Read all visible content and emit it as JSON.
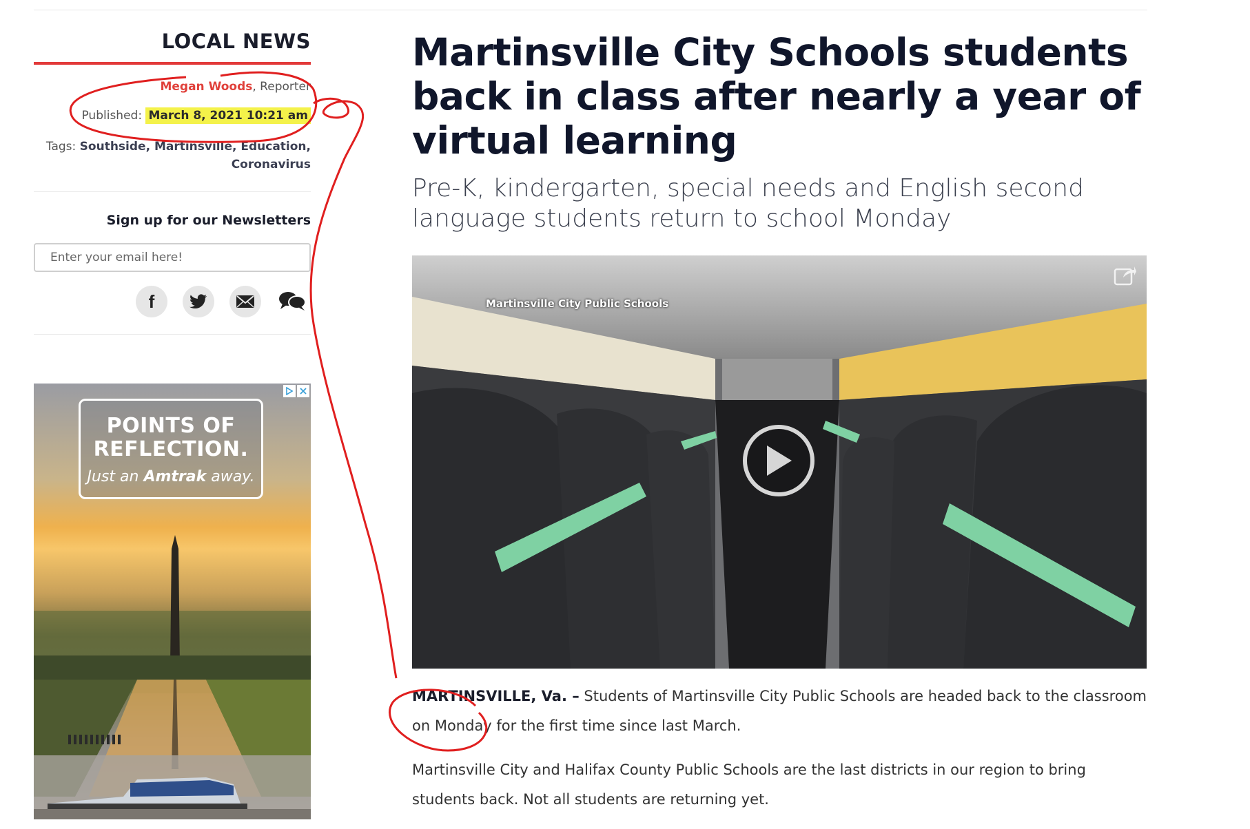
{
  "sidebar": {
    "section_title": "LOCAL NEWS",
    "author": "Megan Woods",
    "author_role": ", Reporter",
    "published_label": "Published: ",
    "published_date": "March 8, 2021 10:21 am",
    "tags_label": "Tags: ",
    "tags": "Southside, Martinsville, Education, Coronavirus",
    "newsletter_title": "Sign up for our Newsletters",
    "email_placeholder": "Enter your email here!",
    "social": [
      "facebook-icon",
      "twitter-icon",
      "email-icon",
      "comments-icon"
    ]
  },
  "ad": {
    "headline_line1": "POINTS OF",
    "headline_line2": "REFLECTION.",
    "tagline_pre": "Just an ",
    "tagline_brand": "Amtrak",
    "tagline_post": " away."
  },
  "article": {
    "headline": "Martinsville City Schools students back in class after nearly a year of virtual learning",
    "subheadline": "Pre-K, kindergarten, special needs and English second language students return to school Monday",
    "video_label": "Martinsville City Public Schools",
    "dateline": "MARTINSVILLE, Va. –",
    "paragraph1": " Students of Martinsville City Public Schools are headed back to the classroom on Monday for the first time since last March.",
    "paragraph2": "Martinsville City and Halifax County Public Schools are the last districts in our region to bring students back. Not all students are returning yet."
  },
  "colors": {
    "accent_red": "#e23a3a",
    "highlight_yellow": "#f4f24a",
    "headline_navy": "#10162b",
    "annotation_red": "#e01f1f"
  }
}
